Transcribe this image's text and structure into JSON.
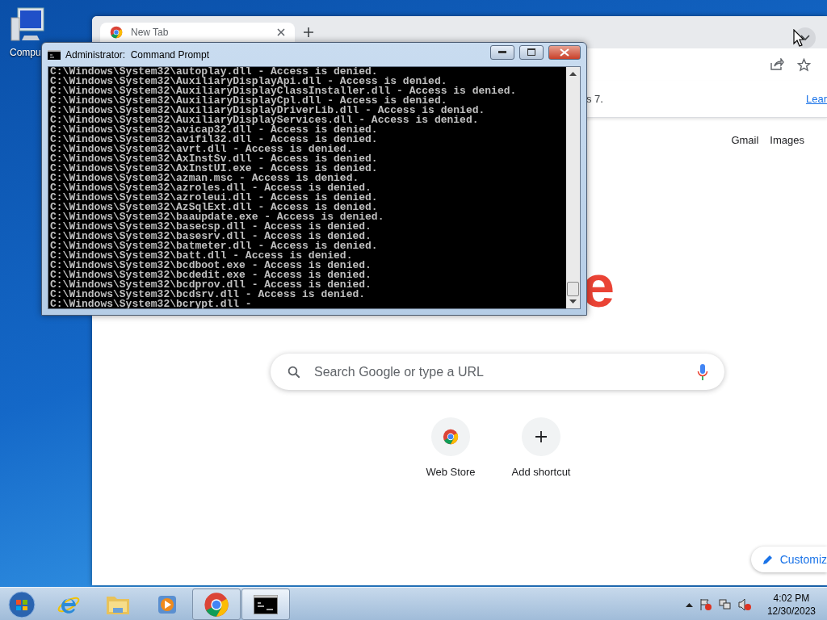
{
  "desktop_icons": [
    {
      "label": "Compu"
    }
  ],
  "browser": {
    "tabs": [
      {
        "title": "New Tab",
        "selected": true
      }
    ],
    "infobar": {
      "text": "s 7.",
      "link": "Lear"
    },
    "top_links": [
      "Gmail",
      "Images"
    ],
    "logo_visible": "e",
    "search": {
      "placeholder": "Search Google or type a URL"
    },
    "shortcuts": [
      {
        "kind": "site",
        "label": "Web Store"
      },
      {
        "kind": "add",
        "label": "Add shortcut"
      }
    ],
    "customize_button": "Customiz"
  },
  "console": {
    "title": "Administrator:  Command Prompt",
    "lines": [
      "C:\\Windows\\System32\\autoplay.dll - Access is denied.",
      "C:\\Windows\\System32\\AuxiliaryDisplayApi.dll - Access is denied.",
      "C:\\Windows\\System32\\AuxiliaryDisplayClassInstaller.dll - Access is denied.",
      "C:\\Windows\\System32\\AuxiliaryDisplayCpl.dll - Access is denied.",
      "C:\\Windows\\System32\\AuxiliaryDisplayDriverLib.dll - Access is denied.",
      "C:\\Windows\\System32\\AuxiliaryDisplayServices.dll - Access is denied.",
      "C:\\Windows\\System32\\avicap32.dll - Access is denied.",
      "C:\\Windows\\System32\\avifil32.dll - Access is denied.",
      "C:\\Windows\\System32\\avrt.dll - Access is denied.",
      "C:\\Windows\\System32\\AxInstSv.dll - Access is denied.",
      "C:\\Windows\\System32\\AxInstUI.exe - Access is denied.",
      "C:\\Windows\\System32\\azman.msc - Access is denied.",
      "C:\\Windows\\System32\\azroles.dll - Access is denied.",
      "C:\\Windows\\System32\\azroleui.dll - Access is denied.",
      "C:\\Windows\\System32\\AzSqlExt.dll - Access is denied.",
      "C:\\Windows\\System32\\baaupdate.exe - Access is denied.",
      "C:\\Windows\\System32\\basecsp.dll - Access is denied.",
      "C:\\Windows\\System32\\basesrv.dll - Access is denied.",
      "C:\\Windows\\System32\\batmeter.dll - Access is denied.",
      "C:\\Windows\\System32\\batt.dll - Access is denied.",
      "C:\\Windows\\System32\\bcdboot.exe - Access is denied.",
      "C:\\Windows\\System32\\bcdedit.exe - Access is denied.",
      "C:\\Windows\\System32\\bcdprov.dll - Access is denied.",
      "C:\\Windows\\System32\\bcdsrv.dll - Access is denied.",
      "C:\\Windows\\System32\\bcrypt.dll -"
    ]
  },
  "taskbar": {
    "items": [
      {
        "kind": "ie",
        "open": false,
        "selected": false
      },
      {
        "kind": "explorer",
        "open": false,
        "selected": false
      },
      {
        "kind": "media",
        "open": false,
        "selected": false
      },
      {
        "kind": "chrome",
        "open": true,
        "selected": false
      },
      {
        "kind": "cmd",
        "open": true,
        "selected": true
      }
    ],
    "clock": {
      "time": "4:02 PM",
      "date": "12/30/2023"
    }
  }
}
